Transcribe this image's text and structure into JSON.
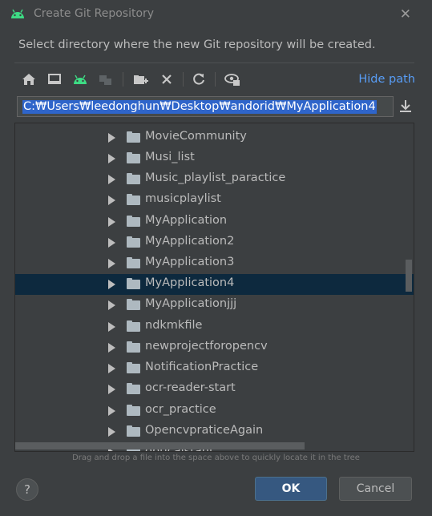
{
  "window": {
    "title": "Create Git Repository"
  },
  "prompt": "Select directory where the new Git repository will be created.",
  "toolbar": {
    "icons": [
      "home-icon",
      "desktop-icon",
      "android-icon",
      "module-icon",
      "new-folder-icon",
      "delete-icon",
      "refresh-icon",
      "show-hidden-icon"
    ],
    "hide_path_label": "Hide path"
  },
  "path": {
    "value": "C:₩Users₩leedonghun₩Desktop₩andorid₩MyApplication4"
  },
  "tree": {
    "items": [
      {
        "label": "MovieCommunity"
      },
      {
        "label": "Musi_list"
      },
      {
        "label": "Music_playlist_paractice"
      },
      {
        "label": "musicplaylist"
      },
      {
        "label": "MyApplication"
      },
      {
        "label": "MyApplication2"
      },
      {
        "label": "MyApplication3"
      },
      {
        "label": "MyApplication4"
      },
      {
        "label": "MyApplicationjjj"
      },
      {
        "label": "ndkmkfile"
      },
      {
        "label": "newprojectforopencv"
      },
      {
        "label": "NotificationPractice"
      },
      {
        "label": "ocr-reader-start"
      },
      {
        "label": "ocr_practice"
      },
      {
        "label": "OpencvpraticeAgain"
      },
      {
        "label": "opticalstant"
      }
    ],
    "selected_label": "MyApplication4"
  },
  "hint": "Drag and drop a file into the space above to quickly locate it in the tree",
  "buttons": {
    "help": "?",
    "ok": "OK",
    "cancel": "Cancel"
  },
  "colors": {
    "background": "#3c3f41",
    "accent": "#589df6",
    "selection": "#0d293e",
    "ok_button": "#365880"
  }
}
